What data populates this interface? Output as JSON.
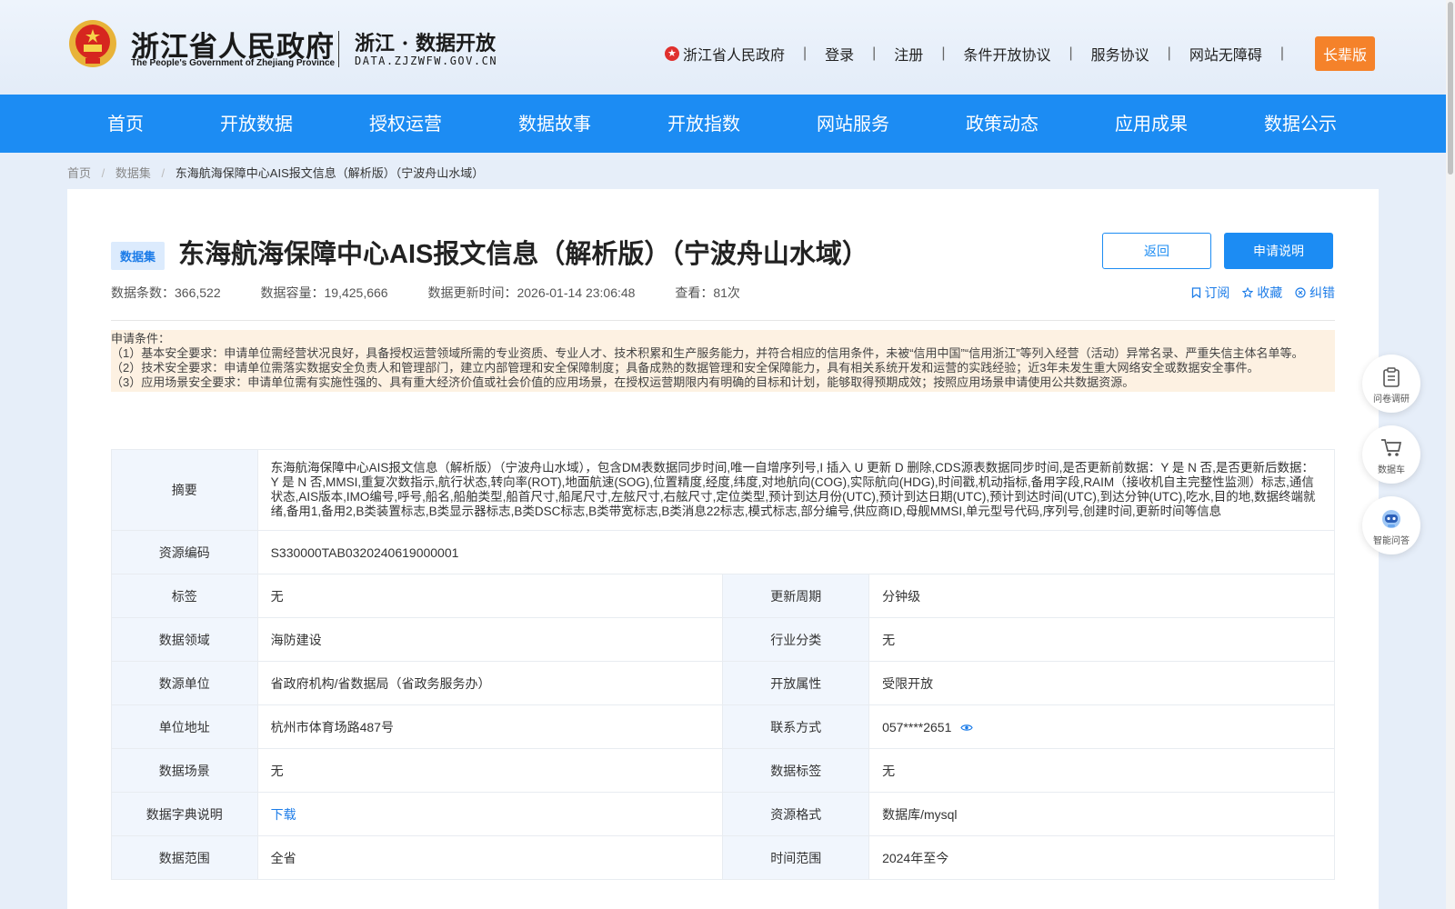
{
  "header": {
    "logo_cn": "浙江省人民政府",
    "logo_en": "The People's Government of Zhejiang Province",
    "site_cn": "浙江 · 数据开放",
    "site_en": "DATA.ZJZWFW.GOV.CN",
    "links": [
      "浙江省人民政府",
      "登录",
      "注册",
      "条件开放协议",
      "服务协议",
      "网站无障碍"
    ],
    "elder_mode": "长辈版"
  },
  "nav": [
    "首页",
    "开放数据",
    "授权运营",
    "数据故事",
    "开放指数",
    "网站服务",
    "政策动态",
    "应用成果",
    "数据公示"
  ],
  "breadcrumb": [
    "首页",
    "数据集",
    "东海航海保障中心AIS报文信息（解析版）（宁波舟山水域）"
  ],
  "dataset": {
    "badge": "数据集",
    "title": "东海航海保障中心AIS报文信息（解析版）（宁波舟山水域）",
    "back_label": "返回",
    "apply_label": "申请说明",
    "meta": {
      "records": "数据条数：366,522",
      "capacity": "数据容量：19,425,666",
      "updated": "数据更新时间：2026-01-14 23:06:48",
      "views": "查看：81次"
    },
    "actions": [
      "订阅",
      "收藏",
      "纠错"
    ]
  },
  "notice": {
    "heading": "申请条件：",
    "lines": [
      "（1）基本安全要求：申请单位需经营状况良好，具备授权运营领域所需的专业资质、专业人才、技术积累和生产服务能力，并符合相应的信用条件，未被“信用中国”“信用浙江”等列入经营（活动）异常名录、严重失信主体名单等。",
      "（2）技术安全要求：申请单位需落实数据安全负责人和管理部门，建立内部管理和安全保障制度；具备成熟的数据管理和安全保障能力，具有相关系统开发和运营的实践经验；近3年未发生重大网络安全或数据安全事件。",
      "（3）应用场景安全要求：申请单位需有实施性强的、具有重大经济价值或社会价值的应用场景，在授权运营期限内有明确的目标和计划，能够取得预期成效；按照应用场景申请使用公共数据资源。"
    ]
  },
  "details": {
    "summary_label": "摘要",
    "summary": "东海航海保障中心AIS报文信息（解析版）（宁波舟山水域），包含DM表数据同步时间,唯一自增序列号,I 插入 U 更新 D 删除,CDS源表数据同步时间,是否更新前数据：Y 是 N 否,是否更新后数据：Y 是 N 否,MMSI,重复次数指示,航行状态,转向率(ROT),地面航速(SOG),位置精度,经度,纬度,对地航向(COG),实际航向(HDG),时间戳,机动指标,备用字段,RAIM（接收机自主完整性监测）标志,通信状态,AIS版本,IMO编号,呼号,船名,船舶类型,船首尺寸,船尾尺寸,左舷尺寸,右舷尺寸,定位类型,预计到达月份(UTC),预计到达日期(UTC),预计到达时间(UTC),到达分钟(UTC),吃水,目的地,数据终端就绪,备用1,备用2,B类装置标志,B类显示器标志,B类DSC标志,B类带宽标志,B类消息22标志,模式标志,部分编号,供应商ID,母舰MMSI,单元型号代码,序列号,创建时间,更新时间等信息",
    "code_label": "资源编码",
    "code": "S330000TAB0320240619000001",
    "rows": [
      {
        "l1": "标签",
        "v1": "无",
        "l2": "更新周期",
        "v2": "分钟级"
      },
      {
        "l1": "数据领域",
        "v1": "海防建设",
        "l2": "行业分类",
        "v2": "无"
      },
      {
        "l1": "数源单位",
        "v1": "省政府机构/省数据局（省政务服务办）",
        "l2": "开放属性",
        "v2": "受限开放"
      },
      {
        "l1": "单位地址",
        "v1": "杭州市体育场路487号",
        "l2": "联系方式",
        "v2": "057****2651"
      },
      {
        "l1": "数据场景",
        "v1": "无",
        "l2": "数据标签",
        "v2": "无"
      },
      {
        "l1": "数据字典说明",
        "v1": "下载",
        "l2": "资源格式",
        "v2": "数据库/mysql"
      },
      {
        "l1": "数据范围",
        "v1": "全省",
        "l2": "时间范围",
        "v2": "2024年至今"
      }
    ]
  },
  "float_buttons": [
    "问卷调研",
    "数据车",
    "智能问答"
  ],
  "colors": {
    "primary": "#1c8cf3",
    "elder": "#f5822a",
    "notice_bg": "#fdf1e2",
    "label_bg": "#f1f6fd"
  }
}
